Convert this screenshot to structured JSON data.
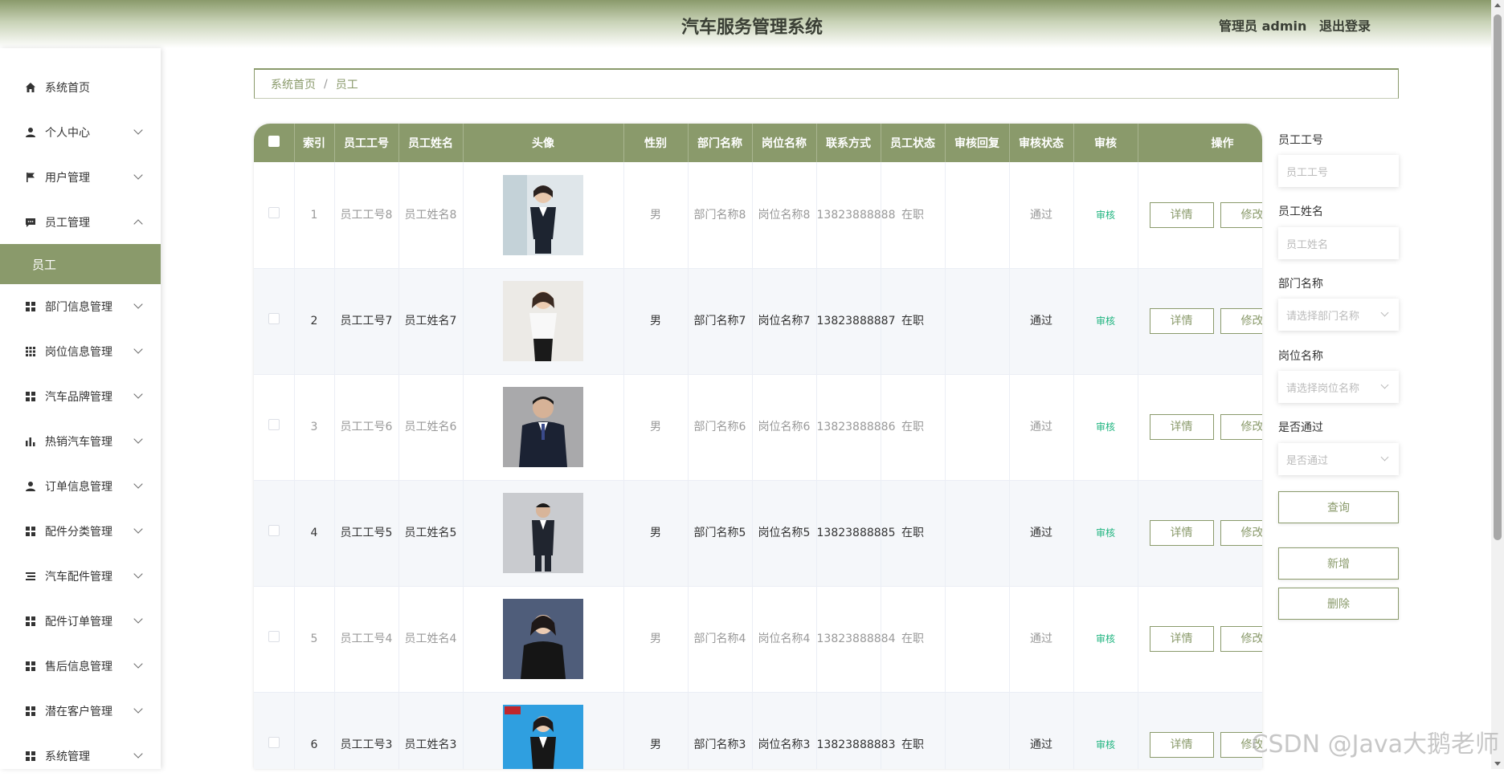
{
  "header": {
    "title": "汽车服务管理系统",
    "user_label": "管理员 admin",
    "logout": "退出登录"
  },
  "sidebar": {
    "items": [
      {
        "label": "系统首页",
        "icon": "home-icon"
      },
      {
        "label": "个人中心",
        "icon": "user-icon"
      },
      {
        "label": "用户管理",
        "icon": "flag-icon"
      },
      {
        "label": "员工管理",
        "icon": "chat-icon"
      },
      {
        "label": "部门信息管理",
        "icon": "grid-icon"
      },
      {
        "label": "岗位信息管理",
        "icon": "grid9-icon"
      },
      {
        "label": "汽车品牌管理",
        "icon": "grid-icon"
      },
      {
        "label": "热销汽车管理",
        "icon": "bar-chart-icon"
      },
      {
        "label": "订单信息管理",
        "icon": "user-icon"
      },
      {
        "label": "配件分类管理",
        "icon": "grid-icon"
      },
      {
        "label": "汽车配件管理",
        "icon": "list-icon"
      },
      {
        "label": "配件订单管理",
        "icon": "grid-icon"
      },
      {
        "label": "售后信息管理",
        "icon": "grid-icon"
      },
      {
        "label": "潜在客户管理",
        "icon": "grid-icon"
      },
      {
        "label": "系统管理",
        "icon": "grid-icon"
      }
    ],
    "active_sub": "员工"
  },
  "breadcrumb": {
    "home": "系统首页",
    "sep": "/",
    "current": "员工"
  },
  "table": {
    "headers": [
      "索引",
      "员工工号",
      "员工姓名",
      "头像",
      "性别",
      "部门名称",
      "岗位名称",
      "联系方式",
      "员工状态",
      "审核回复",
      "审核状态",
      "审核",
      "操作"
    ],
    "rows": [
      {
        "index": "1",
        "no": "员工工号8",
        "name": "员工姓名8",
        "gender": "男",
        "dept": "部门名称8",
        "post": "岗位名称8",
        "phone": "13823888888",
        "status": "在职",
        "reply": "",
        "audit_status": "通过",
        "audit": "审核",
        "detail": "详情",
        "edit": "修改"
      },
      {
        "index": "2",
        "no": "员工工号7",
        "name": "员工姓名7",
        "gender": "男",
        "dept": "部门名称7",
        "post": "岗位名称7",
        "phone": "13823888887",
        "status": "在职",
        "reply": "",
        "audit_status": "通过",
        "audit": "审核",
        "detail": "详情",
        "edit": "修改"
      },
      {
        "index": "3",
        "no": "员工工号6",
        "name": "员工姓名6",
        "gender": "男",
        "dept": "部门名称6",
        "post": "岗位名称6",
        "phone": "13823888886",
        "status": "在职",
        "reply": "",
        "audit_status": "通过",
        "audit": "审核",
        "detail": "详情",
        "edit": "修改"
      },
      {
        "index": "4",
        "no": "员工工号5",
        "name": "员工姓名5",
        "gender": "男",
        "dept": "部门名称5",
        "post": "岗位名称5",
        "phone": "13823888885",
        "status": "在职",
        "reply": "",
        "audit_status": "通过",
        "audit": "审核",
        "detail": "详情",
        "edit": "修改"
      },
      {
        "index": "5",
        "no": "员工工号4",
        "name": "员工姓名4",
        "gender": "男",
        "dept": "部门名称4",
        "post": "岗位名称4",
        "phone": "13823888884",
        "status": "在职",
        "reply": "",
        "audit_status": "通过",
        "audit": "审核",
        "detail": "详情",
        "edit": "修改"
      },
      {
        "index": "6",
        "no": "员工工号3",
        "name": "员工姓名3",
        "gender": "男",
        "dept": "部门名称3",
        "post": "岗位名称3",
        "phone": "13823888883",
        "status": "在职",
        "reply": "",
        "audit_status": "通过",
        "audit": "审核",
        "detail": "详情",
        "edit": "修改"
      }
    ]
  },
  "search": {
    "no_label": "员工工号",
    "no_placeholder": "员工工号",
    "name_label": "员工姓名",
    "name_placeholder": "员工姓名",
    "dept_label": "部门名称",
    "dept_placeholder": "请选择部门名称",
    "post_label": "岗位名称",
    "post_placeholder": "请选择岗位名称",
    "pass_label": "是否通过",
    "pass_placeholder": "是否通过",
    "query": "查询",
    "add": "新增",
    "delete": "删除"
  },
  "watermark": "CSDN @Java大鹅老师",
  "colors": {
    "accent": "#8a9a6b",
    "audit": "#1fb47f"
  }
}
